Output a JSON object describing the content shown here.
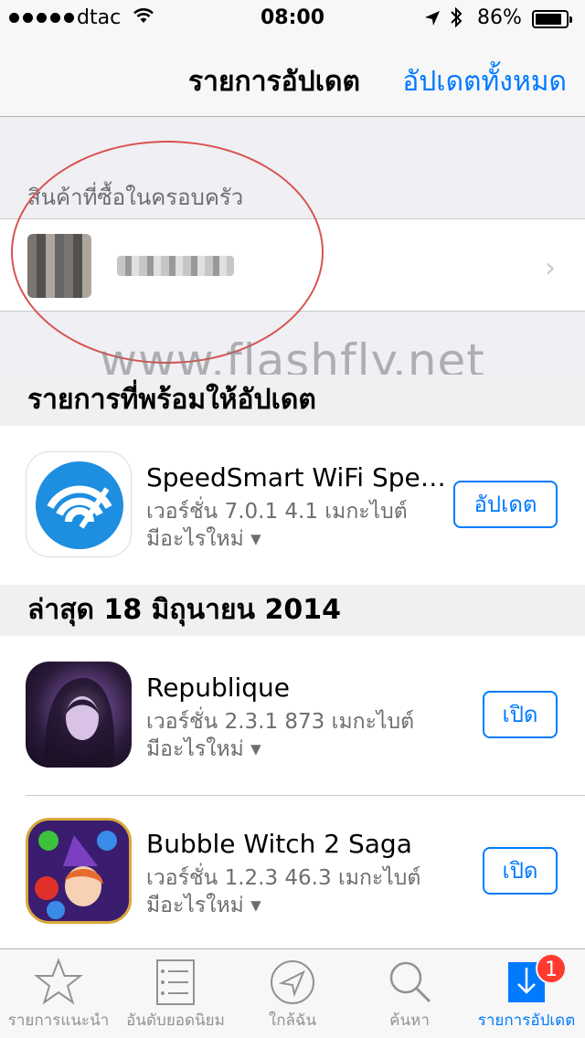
{
  "status_bar": {
    "carrier": "dtac",
    "time": "08:00",
    "battery_percent": "86%",
    "battery_level": 0.86
  },
  "nav": {
    "title": "รายการอัปเดต",
    "update_all": "อัปเดตทั้งหมด"
  },
  "family": {
    "header": "สินค้าที่ซื้อในครอบครัว"
  },
  "watermark": "www.flashfly.net",
  "ready_section": {
    "header": "รายการที่พร้อมให้อัปเดต",
    "apps": [
      {
        "name": "SpeedSmart WiFi Spe…",
        "meta": "เวอร์ชั่น 7.0.1 4.1 เมกะไบต์",
        "more": "มีอะไรใหม่ ▾",
        "button": "อัปเดต",
        "icon": "wifi-speed-icon"
      }
    ]
  },
  "recent_section": {
    "header": "ล่าสุด 18 มิถุนายน 2014",
    "apps": [
      {
        "name": "Republique",
        "meta": "เวอร์ชั่น 2.3.1 873 เมกะไบต์",
        "more": "มีอะไรใหม่ ▾",
        "button": "เปิด",
        "icon": "hooded-woman-icon"
      },
      {
        "name": "Bubble Witch 2 Saga",
        "meta": "เวอร์ชั่น 1.2.3 46.3 เมกะไบต์",
        "more": "มีอะไรใหม่ ▾",
        "button": "เปิด",
        "icon": "bubble-witch-icon"
      }
    ]
  },
  "tabbar": {
    "items": [
      {
        "label": "รายการแนะนำ",
        "icon": "star-icon"
      },
      {
        "label": "อันดับยอดนิยม",
        "icon": "list-icon"
      },
      {
        "label": "ใกล้ฉัน",
        "icon": "location-arrow-icon"
      },
      {
        "label": "ค้นหา",
        "icon": "search-icon"
      },
      {
        "label": "รายการอัปเดต",
        "icon": "download-arrow-icon",
        "badge": "1"
      }
    ]
  },
  "colors": {
    "accent": "#007aff",
    "badge": "#ff3b30",
    "highlight_oval": "#d9534f"
  }
}
